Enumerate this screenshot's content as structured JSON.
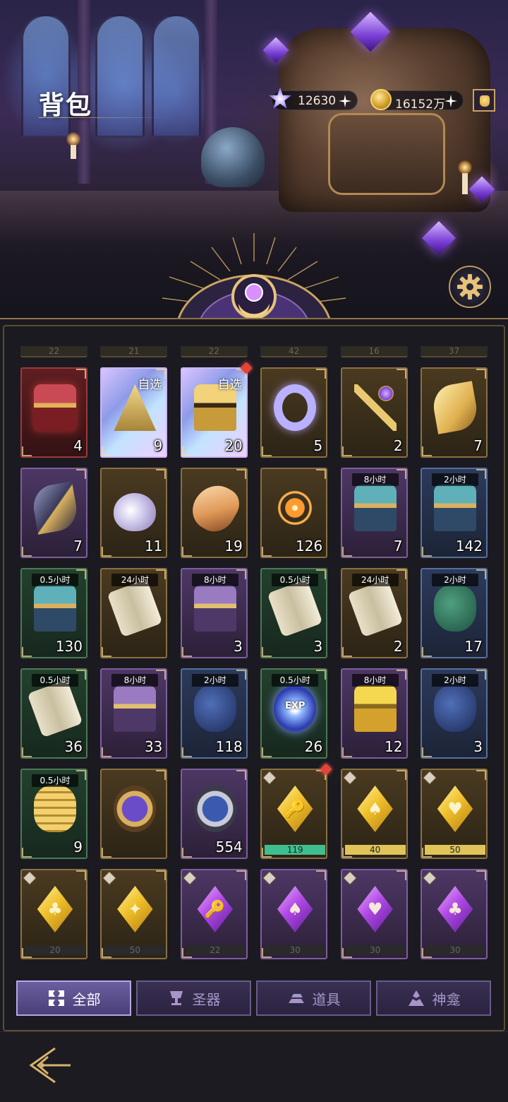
{
  "header": {
    "title": "背包"
  },
  "currencies": [
    {
      "icon": "star-crystal-icon",
      "value": "12630"
    },
    {
      "icon": "gold-coin-icon",
      "value": "16152万"
    }
  ],
  "colors": {
    "accent": "#b7a7e6",
    "gold": "#c9a260",
    "panel": "#1b1a21"
  },
  "peek_row": [
    "22",
    "21",
    "22",
    "42",
    "16",
    "37"
  ],
  "items": [
    {
      "name": "red-treasure-chest",
      "icon": "ic-chest-red",
      "rarity": "r-red",
      "count": "4"
    },
    {
      "name": "mystery-selection-box",
      "icon": "ic-mystery",
      "rarity": "r-rainbow",
      "count": "9",
      "label": "自选"
    },
    {
      "name": "golden-selection-chest",
      "icon": "ic-chest-gold",
      "rarity": "r-rainbow",
      "count": "20",
      "label": "自选",
      "new": true
    },
    {
      "name": "crystal-ring",
      "icon": "ic-ring",
      "rarity": "r-gold",
      "count": "5"
    },
    {
      "name": "amethyst-key",
      "icon": "ic-key",
      "rarity": "r-gold",
      "count": "2"
    },
    {
      "name": "golden-feather",
      "icon": "ic-feather-gold",
      "rarity": "r-gold",
      "count": "7"
    },
    {
      "name": "dark-feather",
      "icon": "ic-feather-dark",
      "rarity": "r-purple",
      "count": "7"
    },
    {
      "name": "pearl-flask",
      "icon": "ic-flask",
      "rarity": "r-gold",
      "count": "11"
    },
    {
      "name": "conch-shell",
      "icon": "ic-shell",
      "rarity": "r-gold",
      "count": "19"
    },
    {
      "name": "fireworks",
      "icon": "ic-firework",
      "rarity": "r-gold",
      "count": "126"
    },
    {
      "name": "purple-chest-8h",
      "icon": "ic-chest-blue",
      "rarity": "r-purple",
      "count": "7",
      "timer": "8小时"
    },
    {
      "name": "blue-chest-2h",
      "icon": "ic-chest-blue",
      "rarity": "r-blue",
      "count": "142",
      "timer": "2小时"
    },
    {
      "name": "green-chest-05h",
      "icon": "ic-chest-blue",
      "rarity": "r-green",
      "count": "130",
      "timer": "0.5小时"
    },
    {
      "name": "gold-treasure-24h",
      "icon": "ic-scroll",
      "rarity": "r-gold",
      "count": "",
      "timer": "24小时"
    },
    {
      "name": "purple-chest-exp-8h",
      "icon": "ic-chest-purple",
      "rarity": "r-purple",
      "count": "3",
      "timer": "8小时"
    },
    {
      "name": "green-scroll-05h",
      "icon": "ic-scroll",
      "rarity": "r-green",
      "count": "3",
      "timer": "0.5小时"
    },
    {
      "name": "gold-scroll-24h",
      "icon": "ic-scroll",
      "rarity": "r-gold",
      "count": "2",
      "timer": "24小时"
    },
    {
      "name": "blue-sack-2h",
      "icon": "ic-sack-green",
      "rarity": "r-blue",
      "count": "17",
      "timer": "2小时"
    },
    {
      "name": "green-scroll-05h-b",
      "icon": "ic-scroll",
      "rarity": "r-green",
      "count": "36",
      "timer": "0.5小时"
    },
    {
      "name": "purple-chest-exp-8h-b",
      "icon": "ic-chest-purple",
      "rarity": "r-purple",
      "count": "33",
      "timer": "8小时"
    },
    {
      "name": "blue-sack-exp-2h",
      "icon": "ic-sack-blue",
      "rarity": "r-blue",
      "count": "118",
      "timer": "2小时"
    },
    {
      "name": "exp-orbs-05h",
      "icon": "ic-exp",
      "rarity": "r-green",
      "count": "26",
      "timer": "0.5小时",
      "exp": "EXP"
    },
    {
      "name": "purple-gold-chest-8h",
      "icon": "ic-chest-yellow",
      "rarity": "r-purple",
      "count": "12",
      "timer": "8小时"
    },
    {
      "name": "blue-coin-sack-2h",
      "icon": "ic-sack-blue",
      "rarity": "r-blue",
      "count": "3",
      "timer": "2小时"
    },
    {
      "name": "coin-stack-05h",
      "icon": "ic-coins",
      "rarity": "r-green",
      "count": "9",
      "timer": "0.5小时"
    },
    {
      "name": "gold-rune-medal",
      "icon": "ic-rune-gold",
      "rarity": "r-gold",
      "count": ""
    },
    {
      "name": "silver-rune-medal",
      "icon": "ic-rune-blue",
      "rarity": "r-purple",
      "count": "554"
    },
    {
      "name": "gold-crystal-keyhole",
      "icon": "ic-crystal-gold",
      "rarity": "r-gold",
      "bar": "119",
      "bar_color": "#3fbf8f",
      "bar_fill": 1.0,
      "new": true,
      "sym": "🔑"
    },
    {
      "name": "gold-crystal-spade",
      "icon": "ic-crystal-gold",
      "rarity": "r-gold",
      "bar": "40",
      "bar_color": "#e0c45a",
      "bar_fill": 1.0,
      "sym": "♠"
    },
    {
      "name": "gold-crystal-heart",
      "icon": "ic-crystal-gold",
      "rarity": "r-gold",
      "bar": "50",
      "bar_color": "#e0c45a",
      "bar_fill": 1.0,
      "sym": "♥"
    },
    {
      "name": "gold-crystal-club",
      "icon": "ic-crystal-gold",
      "rarity": "r-gold",
      "bar": "20",
      "bar_fill": 0,
      "sym": "♣"
    },
    {
      "name": "gold-crystal-star",
      "icon": "ic-crystal-gold",
      "rarity": "r-gold",
      "bar": "50",
      "bar_fill": 0,
      "sym": "✦"
    },
    {
      "name": "purple-crystal-keyhole",
      "icon": "ic-crystal-purple",
      "rarity": "r-purple",
      "bar": "22",
      "bar_fill": 0,
      "sym": "🔑"
    },
    {
      "name": "purple-crystal-spade",
      "icon": "ic-crystal-purple",
      "rarity": "r-purple",
      "bar": "30",
      "bar_fill": 0,
      "sym": "♠"
    },
    {
      "name": "purple-crystal-heart",
      "icon": "ic-crystal-purple",
      "rarity": "r-purple",
      "bar": "30",
      "bar_fill": 0,
      "sym": "♥"
    },
    {
      "name": "purple-crystal-club",
      "icon": "ic-crystal-purple",
      "rarity": "r-purple",
      "bar": "30",
      "bar_fill": 0,
      "sym": "♣"
    }
  ],
  "tabs": [
    {
      "id": "all",
      "label": "全部",
      "active": true
    },
    {
      "id": "relics",
      "label": "圣器"
    },
    {
      "id": "props",
      "label": "道具"
    },
    {
      "id": "shrine",
      "label": "神龛"
    }
  ]
}
